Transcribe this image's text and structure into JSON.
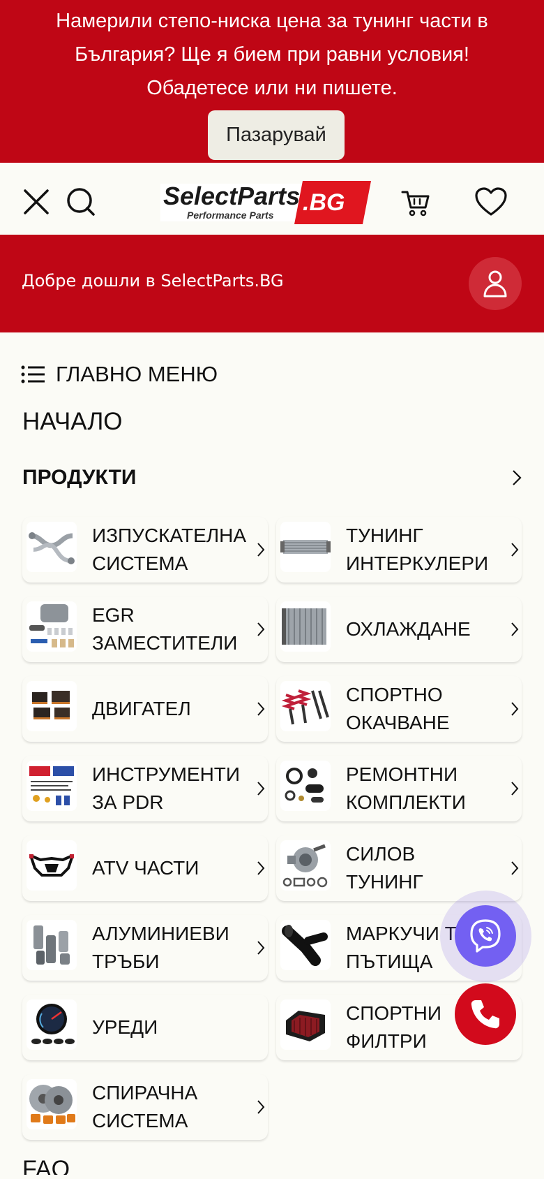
{
  "promo": {
    "text": "Намерили степо-ниска цена за тунинг части в България? Ще я бием при равни условия! Обадетесе или ни пишете.",
    "button_label": "Пазарувай"
  },
  "header": {
    "logo_main": "SelectParts",
    "logo_suffix": ".BG",
    "logo_tagline": "Performance Parts"
  },
  "welcome": {
    "text": "Добре дошли в SelectParts.BG"
  },
  "menu": {
    "title": "ГЛАВНО МЕНЮ",
    "home": "НАЧАЛО",
    "products": "ПРОДУКТИ",
    "faq": "FAQ",
    "categories": [
      {
        "label": "Изпускателна система",
        "icon": "exhaust-manifold"
      },
      {
        "label": "Тунинг интеркулери",
        "icon": "intercooler"
      },
      {
        "label": "EGR заместители",
        "icon": "egr-kit"
      },
      {
        "label": "Охлаждане",
        "icon": "radiator"
      },
      {
        "label": "Двигател",
        "icon": "engine-parts"
      },
      {
        "label": "Спортно окачване",
        "icon": "coilovers"
      },
      {
        "label": "Инструменти за PDR",
        "icon": "pdr-tools"
      },
      {
        "label": "Ремонтни комплекти",
        "icon": "repair-kit"
      },
      {
        "label": "ATV части",
        "icon": "atv-bumper"
      },
      {
        "label": "Силов тунинг",
        "icon": "turbocharger"
      },
      {
        "label": "Алуминиеви тръби",
        "icon": "aluminum-pipes"
      },
      {
        "label": "Маркучи т... пътища",
        "icon": "silicone-hose"
      },
      {
        "label": "Уреди",
        "icon": "gauges"
      },
      {
        "label": "Спортни филтри",
        "icon": "air-filter"
      },
      {
        "label": "Спирачна система",
        "icon": "brake-discs"
      }
    ]
  },
  "colors": {
    "brand_red": "#bf0615",
    "viber": "#7360f2",
    "phone": "#d20a1c",
    "background": "#fbfbf6"
  }
}
